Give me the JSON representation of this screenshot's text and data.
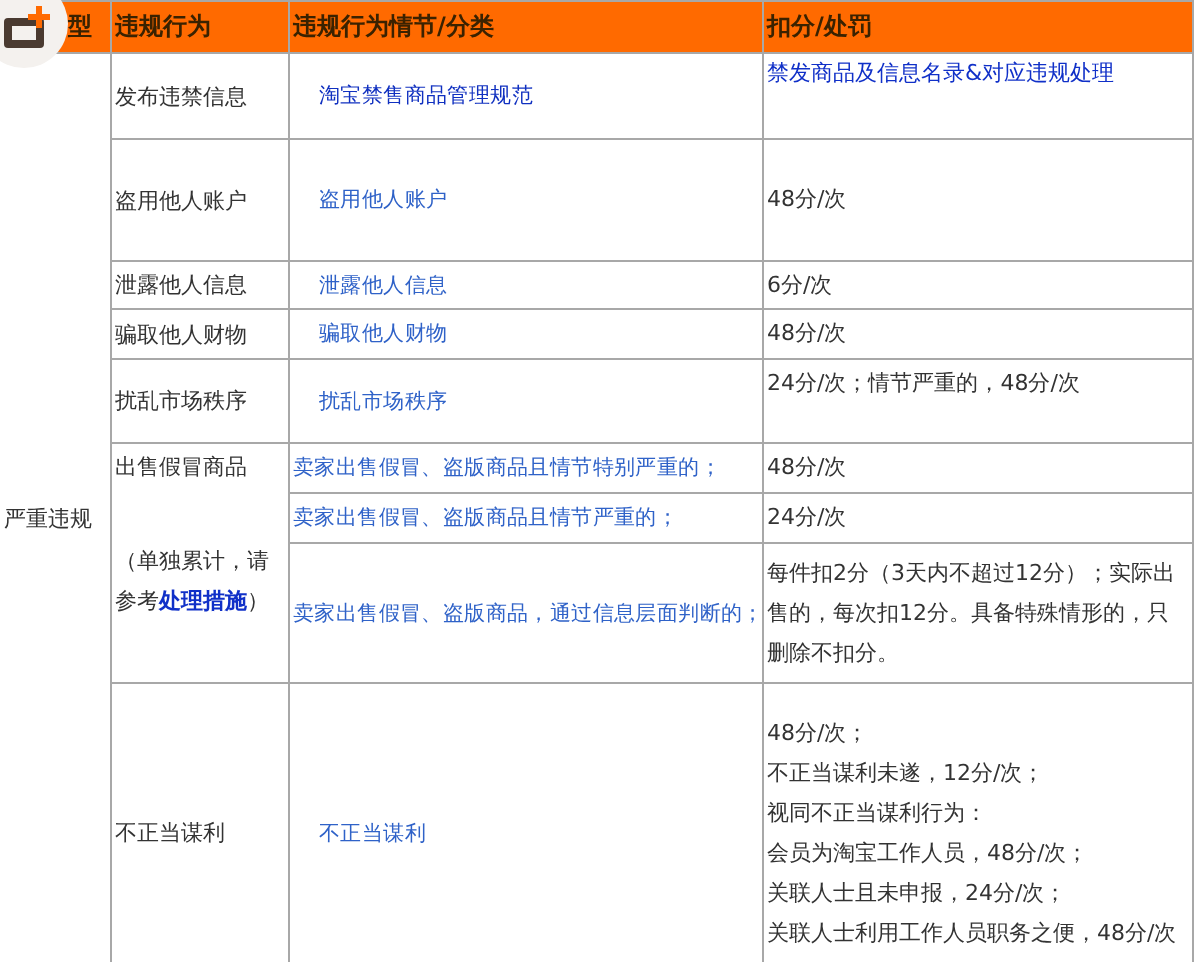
{
  "header": [
    "型",
    "违规行为",
    "违规行为情节/分类",
    "扣分/处罚"
  ],
  "category": "严重违规",
  "groups": [
    {
      "behavior": "发布违禁信息",
      "entries": [
        {
          "detail": "淘宝禁售商品管理规范",
          "penalty": {
            "kind": "link",
            "lines": [
              "禁发商品及信息名录&对应违规处理"
            ]
          }
        }
      ]
    },
    {
      "behavior": "盗用他人账户",
      "entries": [
        {
          "detail": "盗用他人账户",
          "penalty": {
            "kind": "text",
            "lines": [
              "48分/次"
            ]
          }
        }
      ]
    },
    {
      "behavior": "泄露他人信息",
      "entries": [
        {
          "detail": "泄露他人信息",
          "penalty": {
            "kind": "text",
            "lines": [
              "6分/次"
            ]
          }
        }
      ]
    },
    {
      "behavior": "骗取他人财物",
      "entries": [
        {
          "detail": "骗取他人财物",
          "penalty": {
            "kind": "text",
            "lines": [
              "48分/次"
            ]
          }
        }
      ]
    },
    {
      "behavior": "扰乱市场秩序",
      "entries": [
        {
          "detail": "扰乱市场秩序",
          "penalty": {
            "kind": "text",
            "lines": [
              "24分/次；情节严重的，48分/次"
            ]
          }
        }
      ]
    },
    {
      "behavior": "出售假冒商品",
      "note": {
        "before": "（单独累计，请参考",
        "link": "处理措施",
        "after": "）"
      },
      "entries": [
        {
          "detail": "卖家出售假冒、盗版商品且情节特别严重的；",
          "penalty": {
            "kind": "text",
            "lines": [
              "48分/次"
            ]
          }
        },
        {
          "detail": "卖家出售假冒、盗版商品且情节严重的；",
          "penalty": {
            "kind": "text",
            "lines": [
              "24分/次"
            ]
          }
        },
        {
          "detail": "卖家出售假冒、盗版商品，通过信息层面判断的；",
          "penalty": {
            "kind": "text",
            "lines": [
              "每件扣2分（3天内不超过12分）；实际出售的，每次扣12分。具备特殊情形的，只删除不扣分。"
            ]
          }
        }
      ]
    },
    {
      "behavior": "不正当谋利",
      "entries": [
        {
          "detail": "不正当谋利",
          "penalty": {
            "kind": "text",
            "lines": [
              "48分/次；",
              "不正当谋利未遂，12分/次；",
              "视同不正当谋利行为：",
              "会员为淘宝工作人员，48分/次；",
              "关联人士且未申报，24分/次；",
              "关联人士利用工作人员职务之便，48分/次"
            ]
          }
        }
      ]
    }
  ]
}
